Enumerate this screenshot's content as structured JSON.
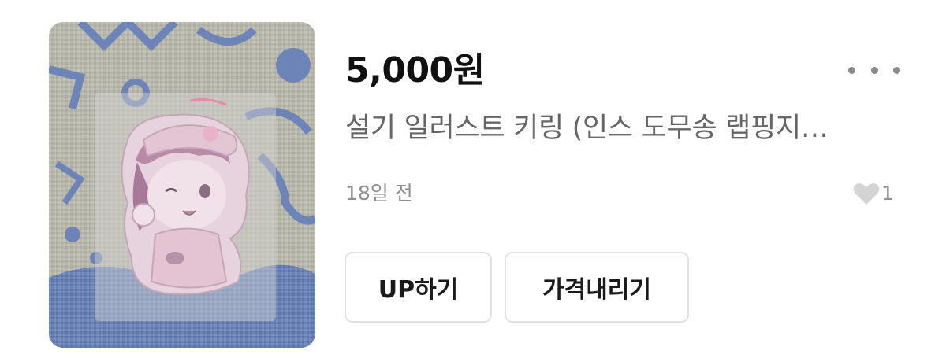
{
  "listing": {
    "price": "5,000원",
    "title": "설기 일러스트 키링 (인스 도무송 랩핑지…",
    "time_ago": "18일 전",
    "like_count": "1",
    "image": {
      "description_icon": "product-photo",
      "colors": {
        "knit_background": "#b9b8ad",
        "knit_pattern": "#6d84b8",
        "keyring_pink": "#d9b6c8"
      }
    }
  },
  "actions": {
    "up_label": "UP하기",
    "price_down_label": "가격내리기",
    "more_icon": "more-dots-icon",
    "like_icon": "heart-icon"
  },
  "colors": {
    "price_text": "#111111",
    "title_text": "#666666",
    "meta_text": "#8f8f8f",
    "button_border": "#e2e2e2",
    "heart_fill": "#d4d4d4"
  }
}
